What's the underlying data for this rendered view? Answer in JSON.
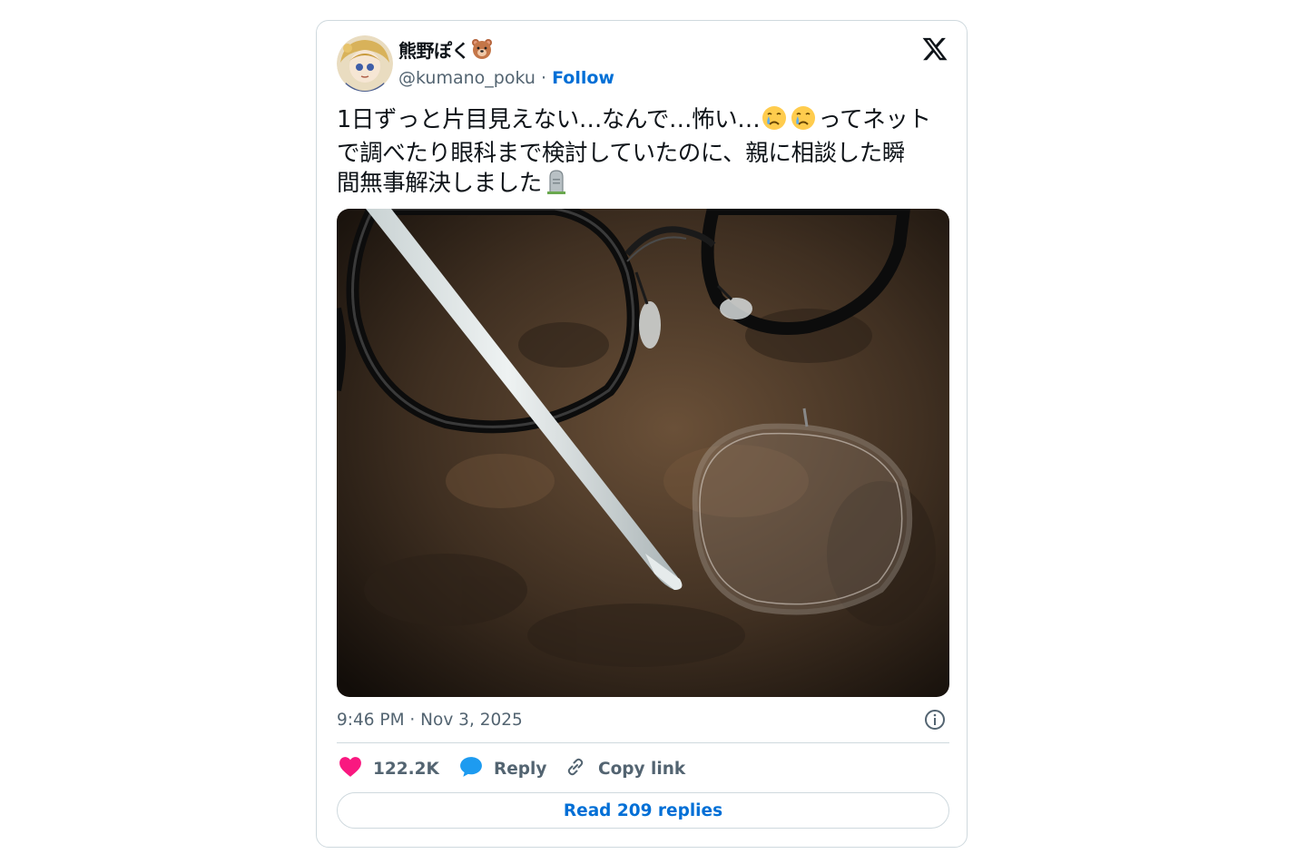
{
  "author": {
    "display_name": "熊野ぽく",
    "name_emoji": "bear-face-icon",
    "handle": "@kumano_poku",
    "separator": "·",
    "follow_label": "Follow",
    "avatar": "avatar-anime-illustration"
  },
  "platform_logo": "x-logo-icon",
  "tweet": {
    "text_parts": [
      "1日ずっと片目見えない…なんで…怖い…",
      "ってネット\nで調べたり眼科まで検討していたのに、親に相談した瞬\n間無事解決しました"
    ],
    "inline_emojis": [
      "crying-face-icon",
      "crying-face-icon",
      "headstone-icon"
    ],
    "media": "photo-glasses-with-lens-fallen-out-and-stylus"
  },
  "timestamp": "9:46 PM · Nov 3, 2025",
  "info_icon": "info-icon",
  "actions": {
    "like_count": "122.2K",
    "reply_label": "Reply",
    "copy_label": "Copy link"
  },
  "read_replies_label": "Read 209 replies",
  "colors": {
    "link_blue": "#006fd6",
    "heart_red": "#f91880",
    "reply_blue": "#1d9bf0",
    "muted_text": "#536471",
    "border": "#cfd9de"
  }
}
